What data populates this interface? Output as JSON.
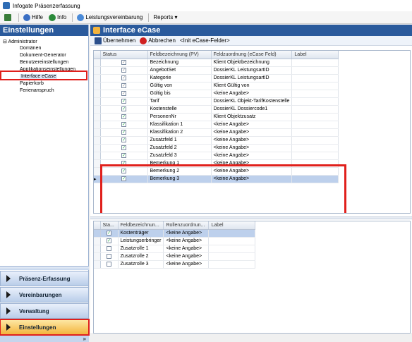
{
  "window": {
    "title": "Infogate Präsenzerfassung"
  },
  "menubar": {
    "hilfe": "Hilfe",
    "info": "Info",
    "leistungsvereinbarung": "Leistungsvereinbarung",
    "reports": "Reports ▾"
  },
  "left": {
    "title": "Einstellungen",
    "tree": {
      "root": "Administrator",
      "items": [
        "Domänen",
        "Dokument-Generator",
        "Benutzereinstellungen",
        "Applikationseinstellungen",
        "Interface eCase",
        "Papierkorb",
        "Ferienanspruch"
      ]
    },
    "nav": {
      "praesenz": "Präsenz-Erfassung",
      "vereinbarungen": "Vereinbarungen",
      "verwaltung": "Verwaltung",
      "einstellungen": "Einstellungen",
      "more": "»"
    }
  },
  "main": {
    "title": "Interface eCase",
    "toolbar": {
      "save": "Übernehmen",
      "cancel": "Abbrechen",
      "init": "<Init eCase-Felder>"
    },
    "grid1": {
      "headers": [
        "Status",
        "Feldbezeichnung (PV)",
        "Feldzuordnung (eCase Feld)",
        "Label"
      ],
      "rows": [
        [
          "Bezeichnung",
          "Klient Objektbezeichnung"
        ],
        [
          "AngebotSet",
          "DossierKL LeistungsartID"
        ],
        [
          "Kategorie",
          "DossierKL LeistungsartID"
        ],
        [
          "Gültig von",
          "Klient Gültig von"
        ],
        [
          "Gültig bis",
          "<keine Angabe>"
        ],
        [
          "Tarif",
          "DossierKL Objekt-TarifKostenstelle"
        ],
        [
          "Kostenstelle",
          "DossierKL Dossiercode1"
        ],
        [
          "PersonenNr",
          "Klient Objektzusatz"
        ],
        [
          "Klassifikation 1",
          "<keine Angabe>"
        ],
        [
          "Klassifikation 2",
          "<keine Angabe>"
        ],
        [
          "Zusatzfeld 1",
          "<keine Angabe>"
        ],
        [
          "Zusatzfeld 2",
          "<keine Angabe>"
        ],
        [
          "Zusatzfeld 3",
          "<keine Angabe>"
        ],
        [
          "Bemerkung 1",
          "<keine Angabe>"
        ],
        [
          "Bemerkung 2",
          "<keine Angabe>"
        ],
        [
          "Bemerkung 3",
          "<keine Angabe>"
        ]
      ]
    },
    "grid2": {
      "headers": [
        "Sta...",
        "Feldbezeichnun...",
        "Rollenzuordnun...",
        "Label"
      ],
      "rows": [
        [
          "Kostenträger",
          "<keine Angabe>"
        ],
        [
          "Leistungserbringer",
          "<keine Angabe>"
        ],
        [
          "Zusatzrolle 1",
          "<keine Angabe>"
        ],
        [
          "Zusatzrolle 2",
          "<keine Angabe>"
        ],
        [
          "Zusatzrolle 3",
          "<keine Angabe>"
        ]
      ]
    }
  },
  "colors": {
    "accent": "#2a5a9c",
    "highlight": "#e0201c",
    "active_nav": "#f3b43d"
  }
}
